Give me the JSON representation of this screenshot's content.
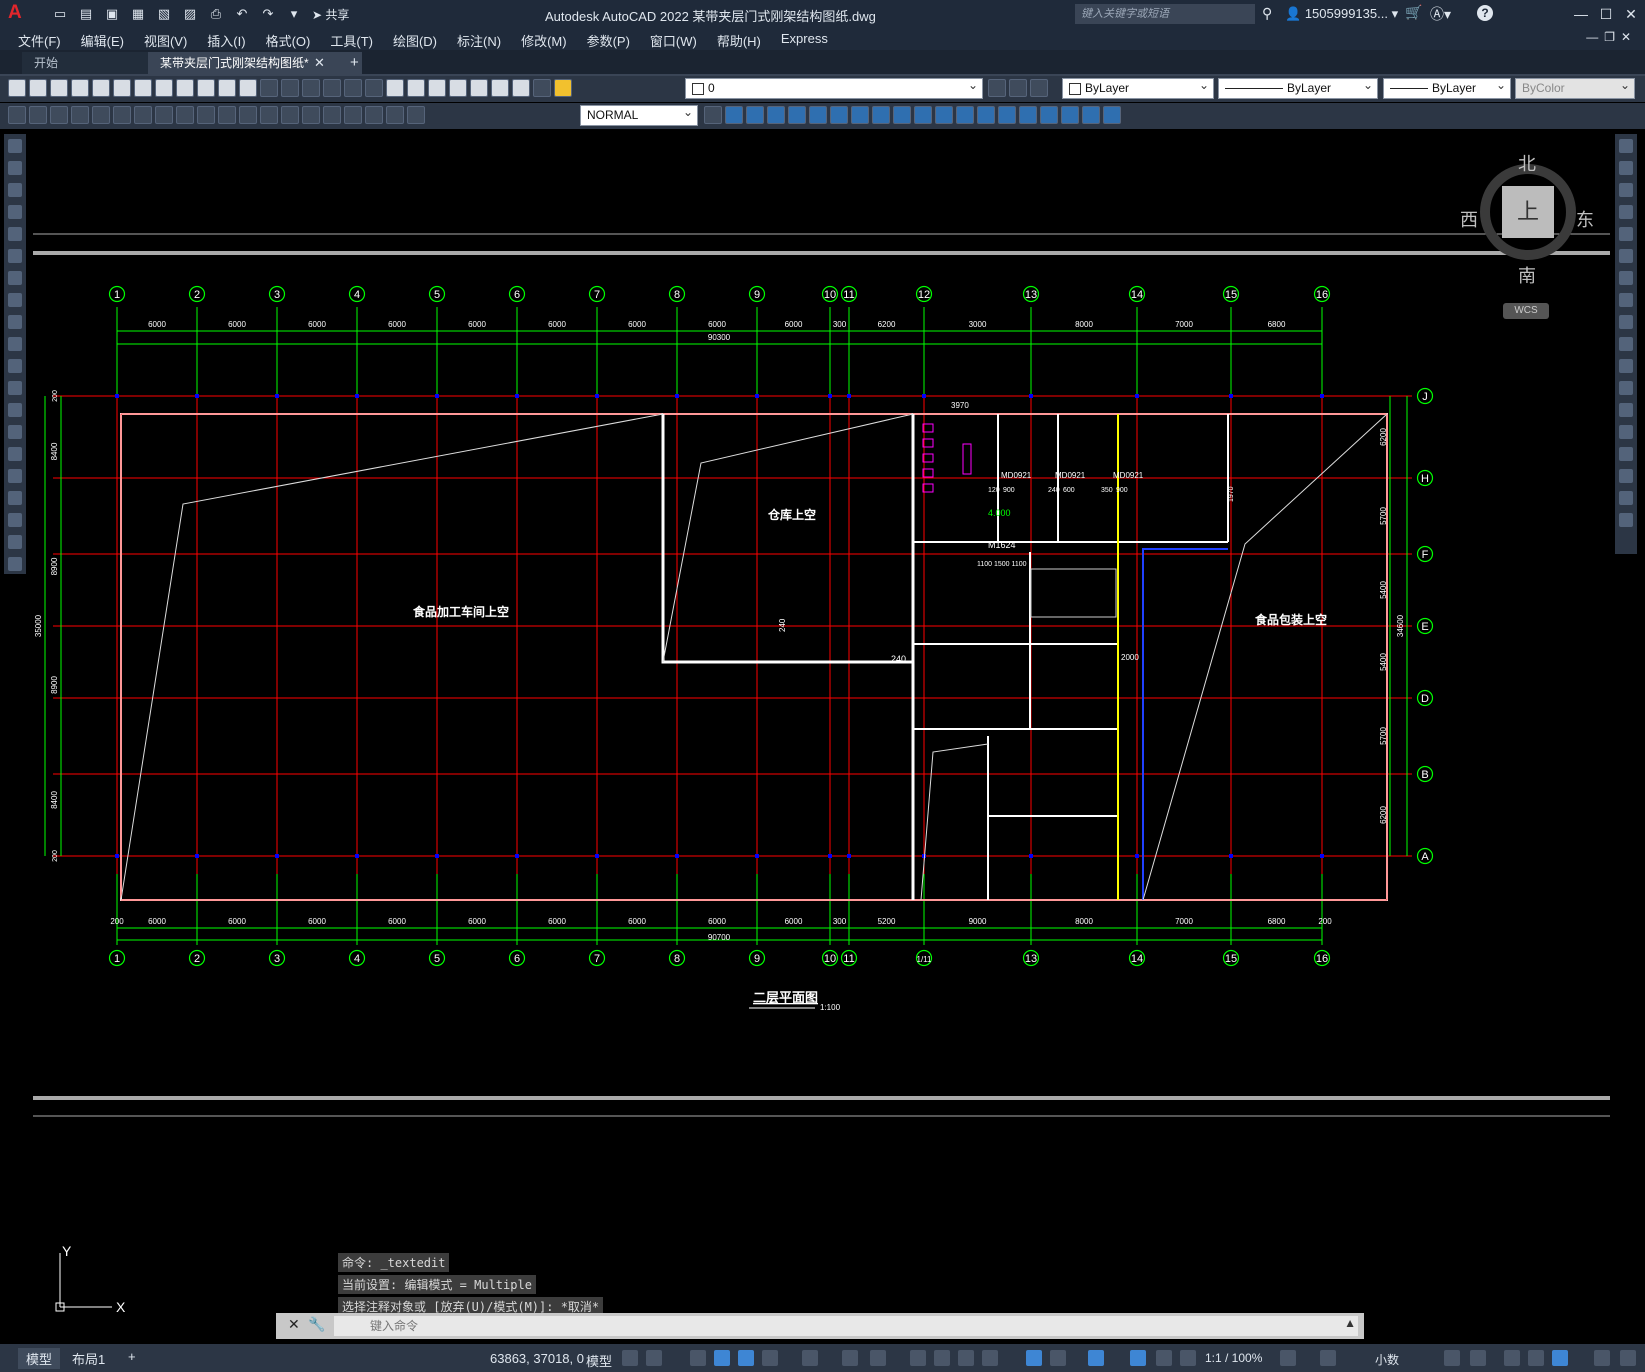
{
  "app": {
    "logo": "A",
    "title": "Autodesk AutoCAD 2022    某带夹层门式刚架结构图纸.dwg",
    "share_label": "共享",
    "search_placeholder": "键入关键字或短语",
    "user": "1505999135...",
    "help": "?"
  },
  "menu": [
    "文件(F)",
    "编辑(E)",
    "视图(V)",
    "插入(I)",
    "格式(O)",
    "工具(T)",
    "绘图(D)",
    "标注(N)",
    "修改(M)",
    "参数(P)",
    "窗口(W)",
    "帮助(H)",
    "Express"
  ],
  "tabs": {
    "start": "开始",
    "drawing": "某带夹层门式刚架结构图纸*"
  },
  "toolbar": {
    "layer": "0",
    "color": "ByLayer",
    "linetype": "ByLayer",
    "lineweight": "ByLayer",
    "plotstyle": "ByColor",
    "dimstyle": "NORMAL"
  },
  "viewcube": {
    "north": "北",
    "south": "南",
    "west": "西",
    "east": "东",
    "face": "上",
    "wcs": "WCS"
  },
  "ucs": {
    "x": "X",
    "y": "Y"
  },
  "drawing": {
    "top_grid_labels": [
      "1",
      "2",
      "3",
      "4",
      "5",
      "6",
      "7",
      "8",
      "9",
      "10",
      "11",
      "12",
      "13",
      "14",
      "15",
      "16"
    ],
    "bottom_grid_labels": [
      "1",
      "2",
      "3",
      "4",
      "5",
      "6",
      "7",
      "8",
      "9",
      "10",
      "11",
      "1/11",
      "13",
      "14",
      "15",
      "16"
    ],
    "row_labels": [
      "J",
      "H",
      "F",
      "E",
      "D",
      "B",
      "A"
    ],
    "top_dims": [
      "6000",
      "6000",
      "6000",
      "6000",
      "6000",
      "6000",
      "6000",
      "6000",
      "6000",
      "300",
      "6200",
      "3000",
      "8000",
      "7000",
      "6800"
    ],
    "top_total": "90300",
    "bottom_dims": [
      "6000",
      "6000",
      "6000",
      "6000",
      "6000",
      "6000",
      "6000",
      "6000",
      "6000",
      "300",
      "5200",
      "9000",
      "8000",
      "7000",
      "6800"
    ],
    "bottom_total": "90700",
    "bottom_end_dims": [
      "200",
      "200"
    ],
    "left_dims": [
      "8400",
      "8900",
      "8900",
      "8400"
    ],
    "left_total": "35000",
    "left_end_dims": [
      "200",
      "200"
    ],
    "right_dims": [
      "6200",
      "5700",
      "5400",
      "5400",
      "5700",
      "6200"
    ],
    "right_total": "34600",
    "rooms": {
      "workshop": "食品加工车间上空",
      "warehouse": "仓库上空",
      "packaging": "食品包装上空"
    },
    "plan_title": "二层平面图",
    "plan_scale": "1:100",
    "annotations": {
      "d240a": "240",
      "d240b": "240",
      "elev": "4.000",
      "m1624": "M1624",
      "d3970": "3970",
      "md0921a": "MD0921",
      "md0921b": "MD0921",
      "md0921c": "MD0921",
      "d1100": "1100 1500 1100",
      "d2000": "2000",
      "d120": "120",
      "d900": "900",
      "d240c": "240",
      "d600": "600",
      "d350": "350",
      "d900b": "900",
      "d1970": "1970"
    }
  },
  "command": {
    "history": [
      "命令: _textedit",
      "当前设置: 编辑模式 = Multiple",
      "选择注释对象或 [放弃(U)/模式(M)]: *取消*"
    ],
    "placeholder": "键入命令"
  },
  "status": {
    "model_tab": "模型",
    "layout_tab": "布局1",
    "add": "+",
    "coords": "63863, 37018, 0",
    "space": "模型",
    "scale": "1:1 / 100%",
    "units": "小数"
  },
  "colors": {
    "grid_green": "#00ff00",
    "axis_red": "#ff0000",
    "wall_white": "#ffffff",
    "column_blue": "#0000ff",
    "yellow": "#ffff00",
    "magenta": "#ff00ff"
  }
}
